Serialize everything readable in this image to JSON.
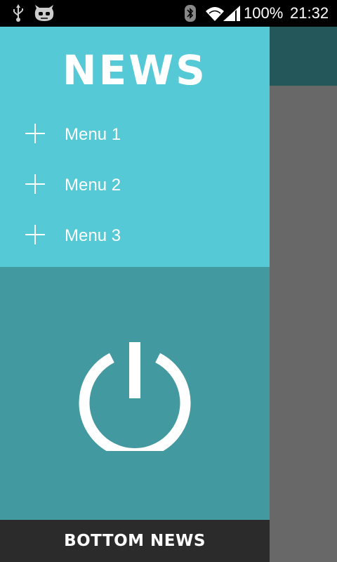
{
  "status_bar": {
    "icons": [
      "usb-icon",
      "cyanogenmod-icon",
      "bluetooth-icon",
      "wifi-icon",
      "signal-icon"
    ],
    "battery": "100%",
    "time": "21:32"
  },
  "drawer": {
    "title": "NEWS",
    "menu_items": [
      {
        "label": "Menu 1",
        "icon": "plus-icon"
      },
      {
        "label": "Menu 2",
        "icon": "plus-icon"
      },
      {
        "label": "Menu 3",
        "icon": "plus-icon"
      }
    ],
    "power_icon": "power-icon",
    "bottom_label": "BOTTOM NEWS"
  },
  "colors": {
    "drawer_top": "#55C9D6",
    "drawer_middle": "#42999F",
    "drawer_bottom": "#2B2B2B",
    "app_bar": "#24575A",
    "content": "#686868",
    "status_bar": "#000000"
  }
}
